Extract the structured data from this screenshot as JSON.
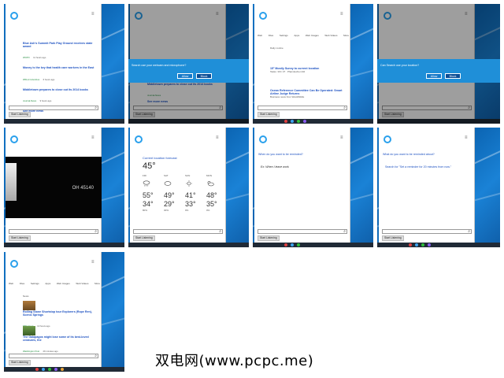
{
  "tiles": {
    "t1": {
      "news": [
        {
          "title": "Blue Ash's Summit Park Play Ground receives state award",
          "meta": "WCPO",
          "time": "11 hours ago"
        },
        {
          "title": "Money is the key that health care workers in the East",
          "meta": "WKLA Columbus",
          "time": "6 hours ago"
        },
        {
          "title": "Middletown prepares to close out its 2014 books",
          "meta": "Journal-News",
          "time": "9 hours ago"
        }
      ],
      "see_more": "See more news",
      "start_listening": "Start Listening"
    },
    "t2": {
      "prompt_text": "Search use your webcam and microphone?",
      "allow": "Allow",
      "block": "Block",
      "news_title": "Middletown prepares to close out its 2014 books",
      "news_meta": "Journal-News",
      "see_more": "See more news",
      "start_listening": "Start Listening"
    },
    "t3": {
      "tabs": [
        "Web",
        "Files",
        "Settings",
        "Apps",
        "Web Images",
        "Web Videos",
        "More"
      ],
      "heading": "Daily routine",
      "item1": "15° Mostly Sunny to current location",
      "item1b": "Tasks: 3/9 / 27 · Pfannkuchen Rd",
      "item2": "Ocean Reference Committee Can Be Operated: Smart Airline Judge Returns",
      "item2b": "Business news from WestMiddle",
      "start_listening": "Start Listening"
    },
    "t4": {
      "prompt_text": "Can Search use your location?",
      "allow": "Allow",
      "block": "Block",
      "start_listening": "Start Listening"
    },
    "t5": {
      "location": "OH 45140",
      "start_listening": "Start Listening"
    },
    "t6": {
      "title": "Current location forecast",
      "now_temp": "45°",
      "days": [
        {
          "name": "FRI",
          "hi": "55°",
          "lo": "34°",
          "pct": "80%"
        },
        {
          "name": "SAT",
          "hi": "49°",
          "lo": "29°",
          "pct": "30%"
        },
        {
          "name": "SUN",
          "hi": "41°",
          "lo": "33°",
          "pct": "0%"
        },
        {
          "name": "MON",
          "hi": "48°",
          "lo": "35°",
          "pct": "0%"
        }
      ],
      "start_listening": "Start Listening"
    },
    "t7": {
      "question": "When do you want to be reminded?",
      "answer": "Ex: When I leave work",
      "start_listening": "Start Listening"
    },
    "t8": {
      "question": "What do you want to be reminded about?",
      "search_text": "Search for \"Set a reminder for 20 minutes from now.\"",
      "start_listening": "Start Listening"
    },
    "t9": {
      "tabs": [
        "Web",
        "Files",
        "Settings",
        "Apps",
        "Web Images",
        "Web Videos",
        "More"
      ],
      "heading": "News",
      "news": [
        {
          "title": "Rolling Stone Shortstop tour Explorers (Rope Ren), Scenic Springs",
          "meta": "NBC News",
          "time": "13 hours ago"
        },
        {
          "title": "The Galapagos might lose some of its best-loved creatures, the",
          "meta": "Washington Post",
          "time": "29 minutes ago"
        }
      ],
      "start_listening": "Start Listening"
    }
  },
  "watermark": "双电网(www.pcpc.me)"
}
